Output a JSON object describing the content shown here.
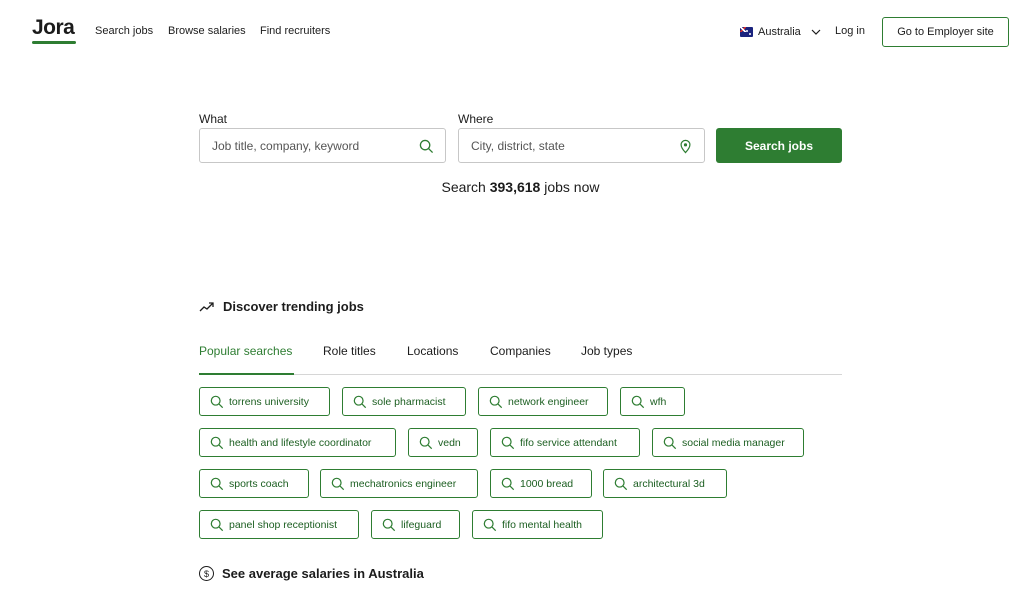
{
  "header": {
    "logo": "Jora",
    "nav": [
      "Search jobs",
      "Browse salaries",
      "Find recruiters"
    ],
    "country": "Australia",
    "login": "Log in",
    "employer_button": "Go to Employer site"
  },
  "search": {
    "what_label": "What",
    "what_placeholder": "Job title, company, keyword",
    "where_label": "Where",
    "where_placeholder": "City, district, state",
    "button": "Search jobs",
    "count_prefix": "Search",
    "count_value": "393,618",
    "count_suffix": "jobs now"
  },
  "trending": {
    "title": "Discover trending jobs",
    "tabs": [
      "Popular searches",
      "Role titles",
      "Locations",
      "Companies",
      "Job types"
    ],
    "chips": [
      "torrens university",
      "sole pharmacist",
      "network engineer",
      "wfh",
      "health and lifestyle coordinator",
      "vedn",
      "fifo service attendant",
      "social media manager",
      "sports coach",
      "mechatronics engineer",
      "1000 bread",
      "architectural 3d",
      "panel shop receptionist",
      "lifeguard",
      "fifo mental health"
    ]
  },
  "salaries": {
    "title": "See average salaries in Australia",
    "icon_symbol": "$"
  },
  "colors": {
    "brand_green": "#2e7d32",
    "chip_text": "#1b5e20",
    "border_gray": "#c7c7c7"
  },
  "icons": [
    "search-icon",
    "location-pin-icon",
    "chevron-down-icon",
    "trending-up-icon",
    "dollar-coin-icon",
    "australia-flag-icon"
  ]
}
